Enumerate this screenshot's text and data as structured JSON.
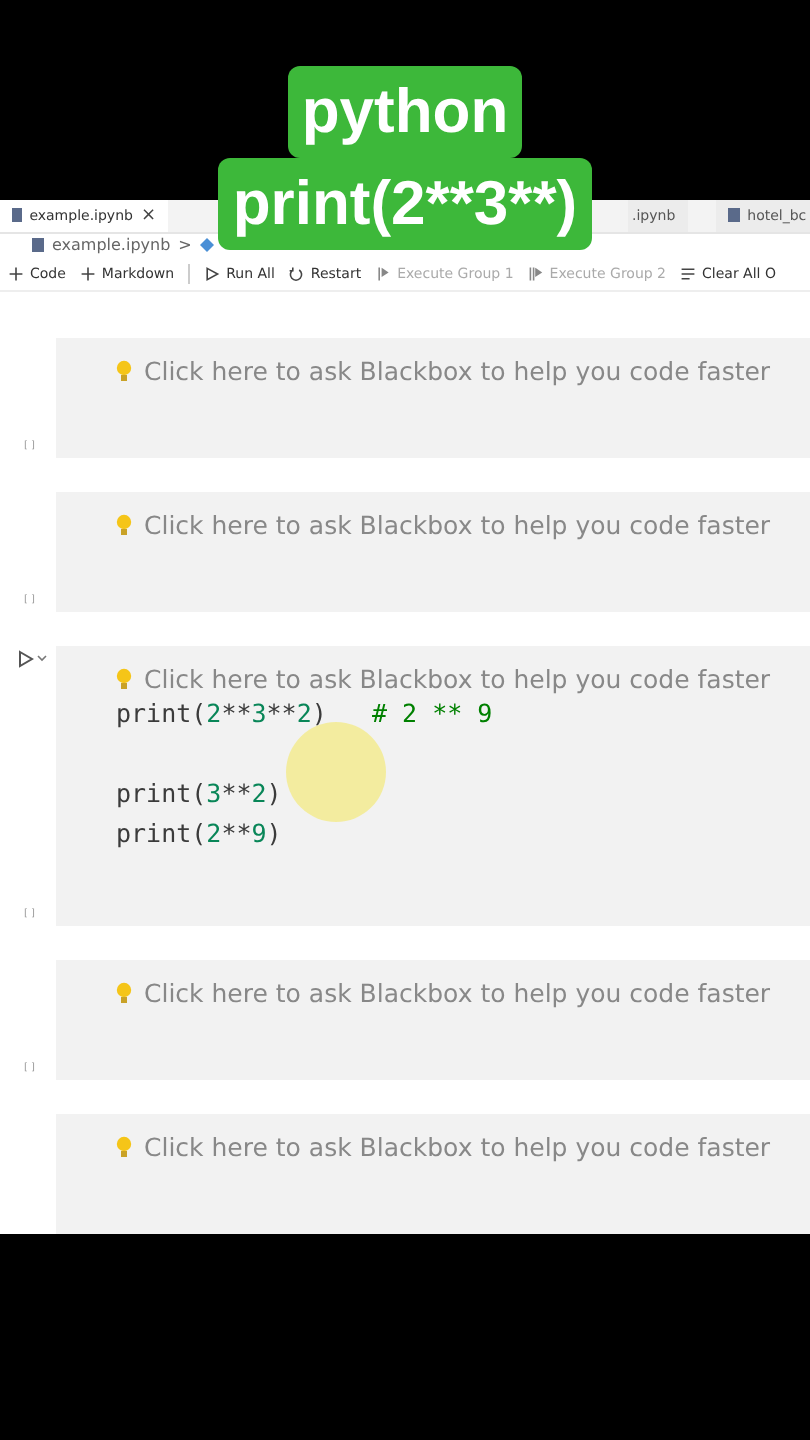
{
  "caption": {
    "lines": [
      "python",
      "print(2**3**)"
    ]
  },
  "tabs": [
    {
      "label": "example.ipynb",
      "close": "×",
      "selected": true
    },
    {
      "label": ".ipynb",
      "selected": false
    },
    {
      "label": "hotel_bc",
      "selected": false
    }
  ],
  "breadcrumb": {
    "file": "example.ipynb",
    "separator": ">"
  },
  "toolbar": [
    {
      "label": "Code",
      "disabled": false
    },
    {
      "label": "Markdown",
      "disabled": false
    },
    {
      "label": "Run All",
      "disabled": false
    },
    {
      "label": "Restart",
      "disabled": false
    },
    {
      "label": "Execute Group 1",
      "disabled": true
    },
    {
      "label": "Execute Group 2",
      "disabled": true
    },
    {
      "label": "Clear All O",
      "disabled": false
    }
  ],
  "cells": [
    {
      "hint": "Click here to ask Blackbox to help you code faster",
      "execution_count": "[ ]",
      "focused": false,
      "pointer_highlight": false
    },
    {
      "hint": "Click here to ask Blackbox to help you code faster",
      "execution_count": "[ ]",
      "focused": false,
      "pointer_highlight": false
    },
    {
      "hint": "Click here to ask Blackbox to help you code faster",
      "code_blocks": [
        [
          "print(2**3**2)   # 2 ** 9"
        ],
        [
          "print(3**2)",
          "print(2**9)"
        ]
      ],
      "execution_count": "[ ]",
      "focused": true,
      "pointer_highlight": true
    },
    {
      "hint": "Click here to ask Blackbox to help you code faster",
      "execution_count": "[ ]",
      "focused": false,
      "pointer_highlight": false
    },
    {
      "hint": "Click here to ask Blackbox to help you code faster",
      "focused": false,
      "pointer_highlight": false
    }
  ]
}
